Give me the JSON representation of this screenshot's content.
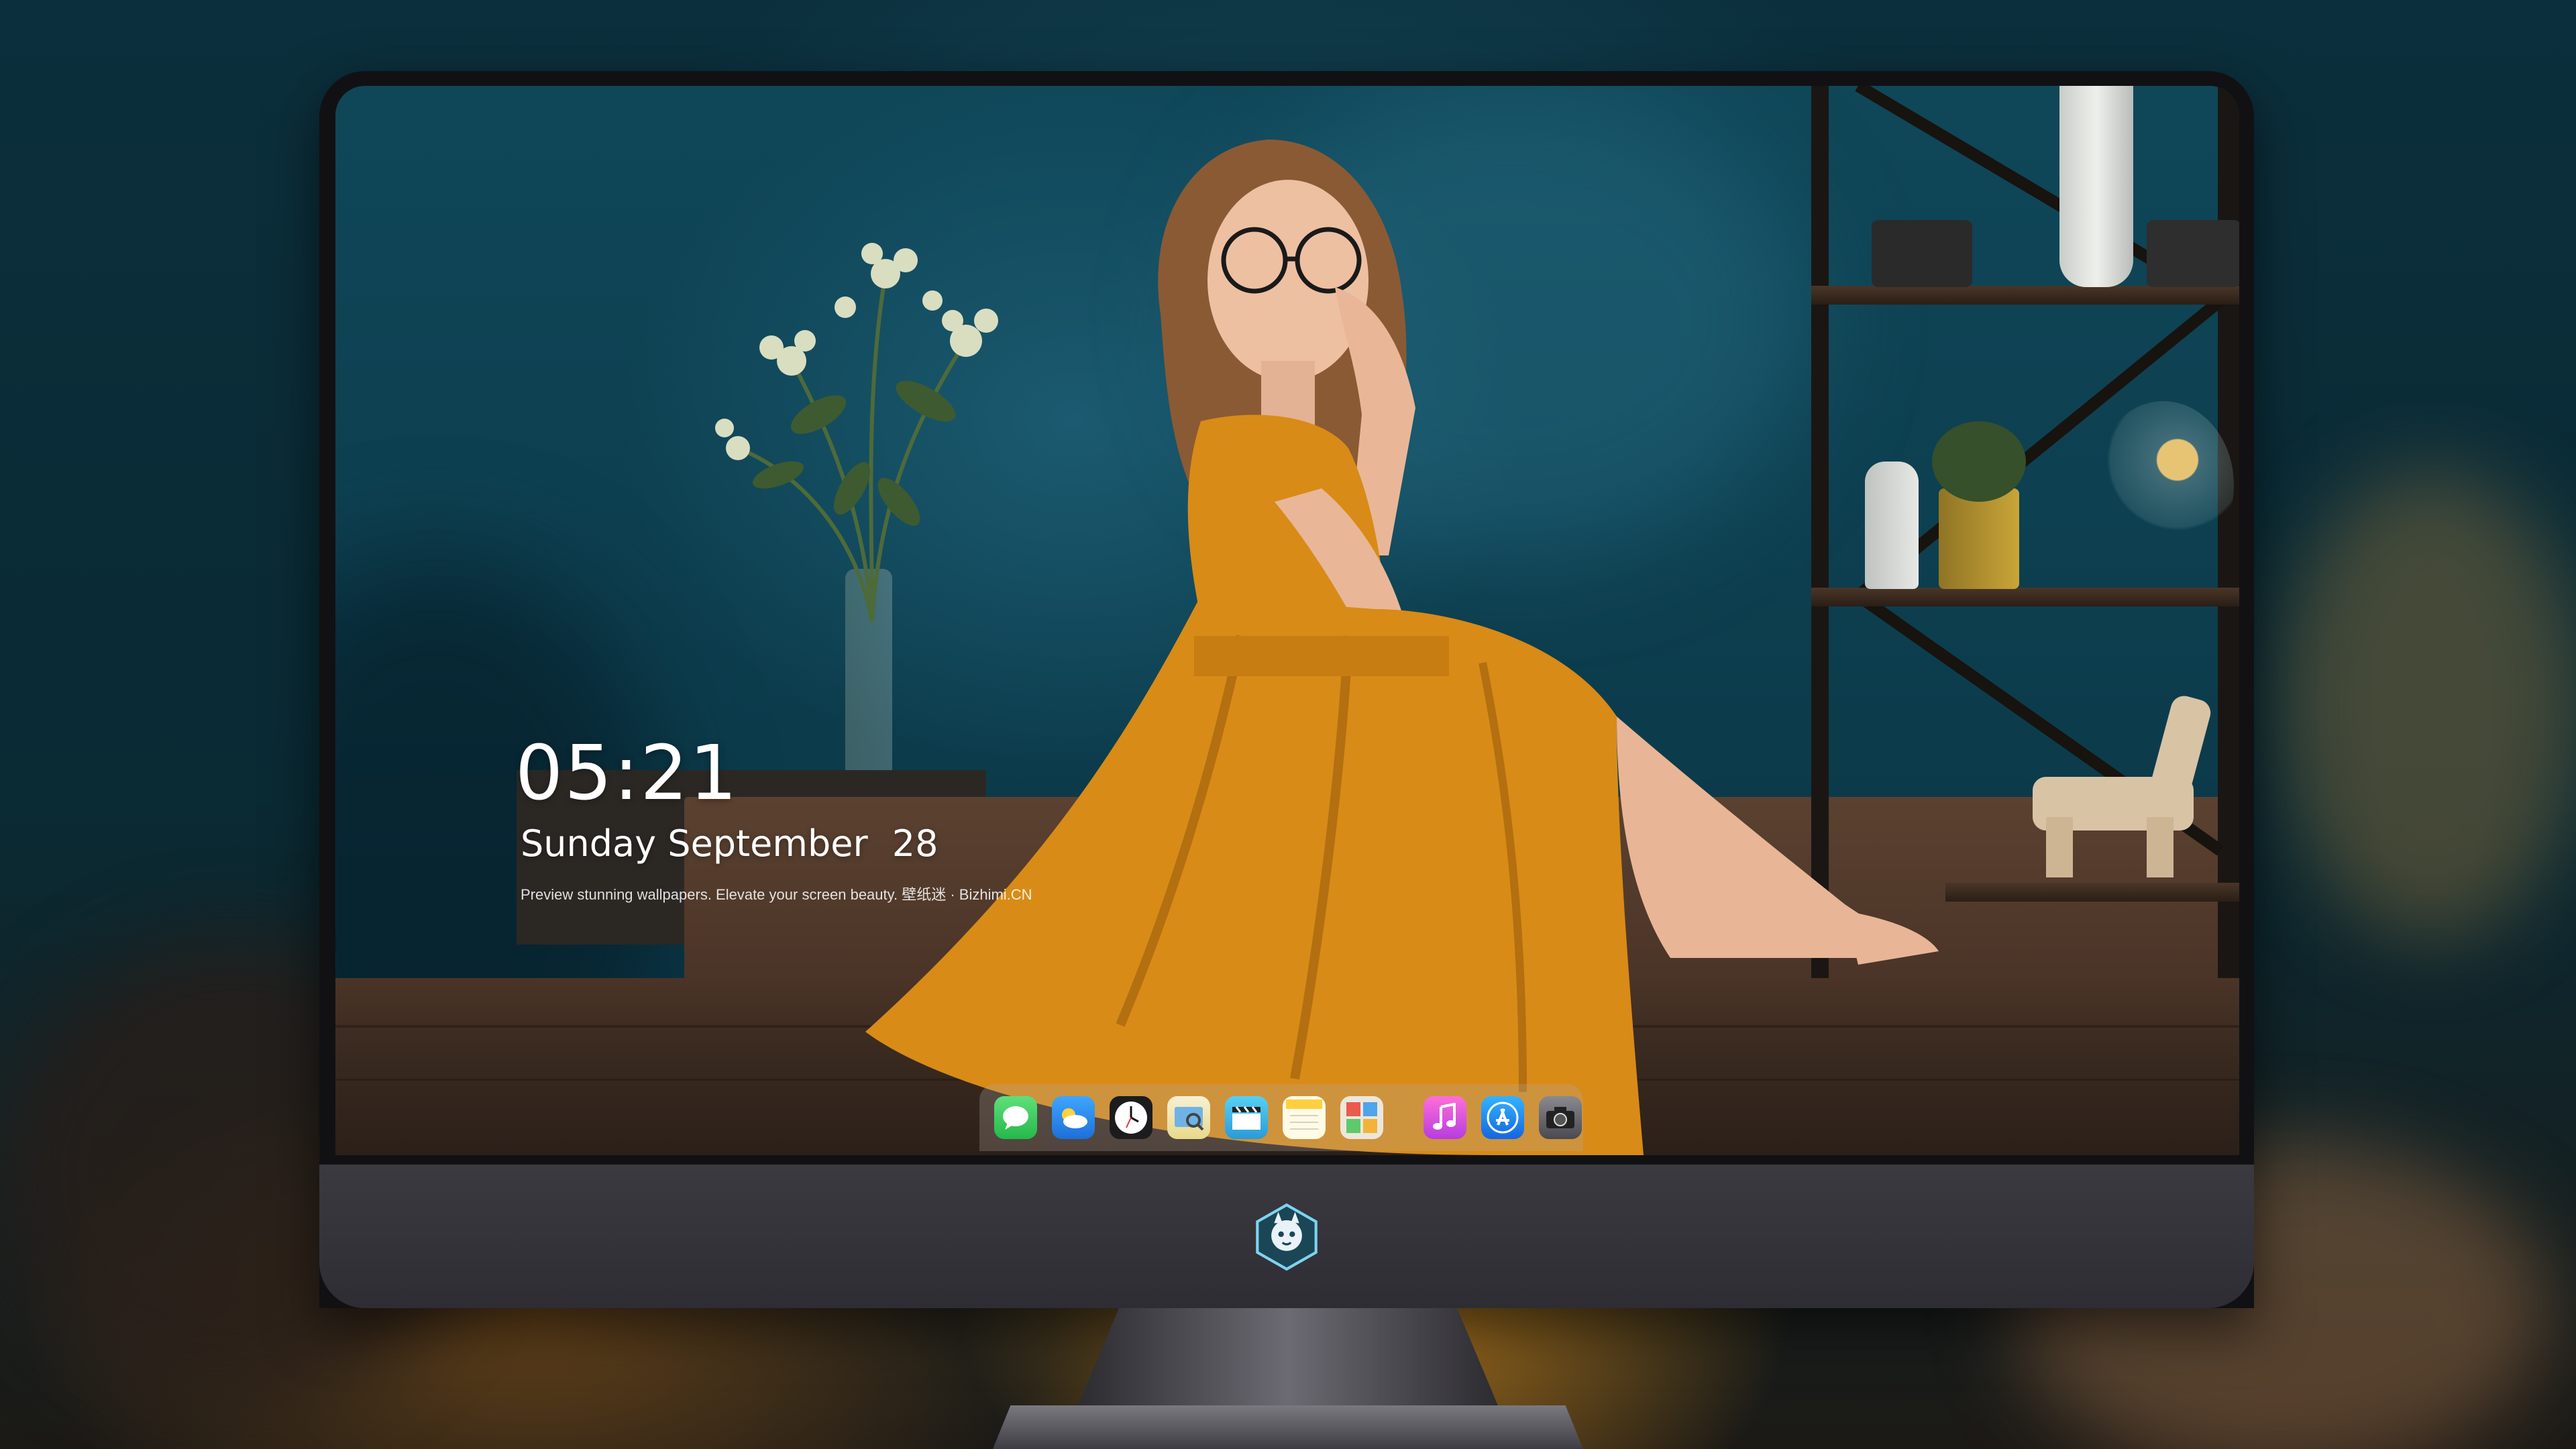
{
  "lock_screen": {
    "time": "05:21",
    "weekday": "Sunday",
    "month": "September",
    "day": "28",
    "tagline": "Preview stunning wallpapers. Elevate your screen beauty. 壁纸迷 · Bizhimi.CN"
  },
  "dock": {
    "apps": [
      {
        "icon": "messages-icon",
        "color": "#34c759"
      },
      {
        "icon": "weather-icon",
        "color": "#2b8cf0"
      },
      {
        "icon": "clock-icon",
        "color": "#1c1c1e"
      },
      {
        "icon": "preview-icon",
        "color": "#f2c94c"
      },
      {
        "icon": "clapper-icon",
        "color": "#3ab0e6"
      },
      {
        "icon": "notes-icon",
        "color": "#ffd84a"
      },
      {
        "icon": "photo-booth-icon",
        "color": "#e9e4d8"
      },
      {
        "icon": "music-icon",
        "color": "#e84fc9"
      },
      {
        "icon": "app-store-icon",
        "color": "#1e8cf5"
      },
      {
        "icon": "camera-icon",
        "color": "#6b6b70"
      }
    ]
  },
  "colors": {
    "wall": "#0f4759",
    "dress": "#d88b17",
    "monitor_chin": "#3b3a40"
  }
}
